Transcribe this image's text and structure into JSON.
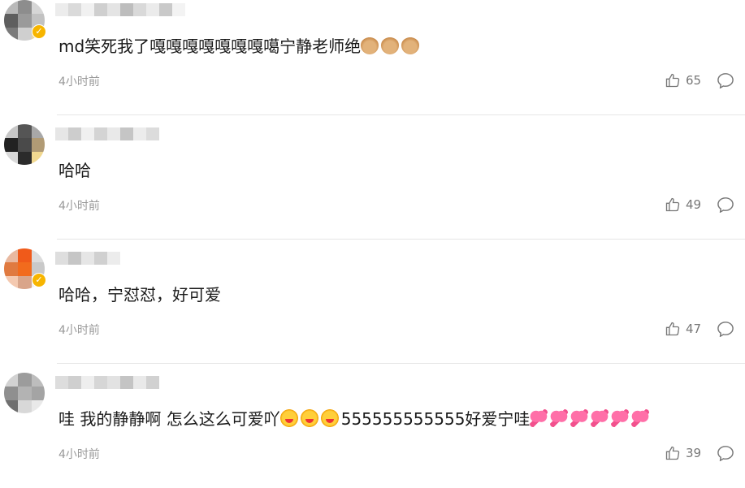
{
  "comments": [
    {
      "text": "md笑死我了嘎嘎嘎嘎嘎嘎嘎噶宁静老师绝",
      "emojis_after": [
        "thumb",
        "thumb",
        "thumb"
      ],
      "time": "4小时前",
      "likes": "65",
      "verified": true
    },
    {
      "text": "哈哈",
      "time": "4小时前",
      "likes": "49",
      "verified": false
    },
    {
      "text": "哈哈，宁怼怼，好可爱",
      "time": "4小时前",
      "likes": "47",
      "verified": true
    },
    {
      "text_part1": "哇 我的静静啊 怎么这么可爱吖",
      "emojis_mid": [
        "face",
        "face",
        "face"
      ],
      "text_part2": "555555555555好爱宁哇",
      "emojis_after": [
        "heart",
        "heart",
        "heart",
        "heart",
        "heart",
        "heart"
      ],
      "time": "4小时前",
      "likes": "39",
      "verified": false
    }
  ],
  "colors": {
    "divider": "#e6e6e6",
    "meta": "#999999",
    "verified_badge": "#f7b500"
  },
  "icons": {
    "like": "thumb-up-icon",
    "reply": "comment-bubble-icon"
  }
}
